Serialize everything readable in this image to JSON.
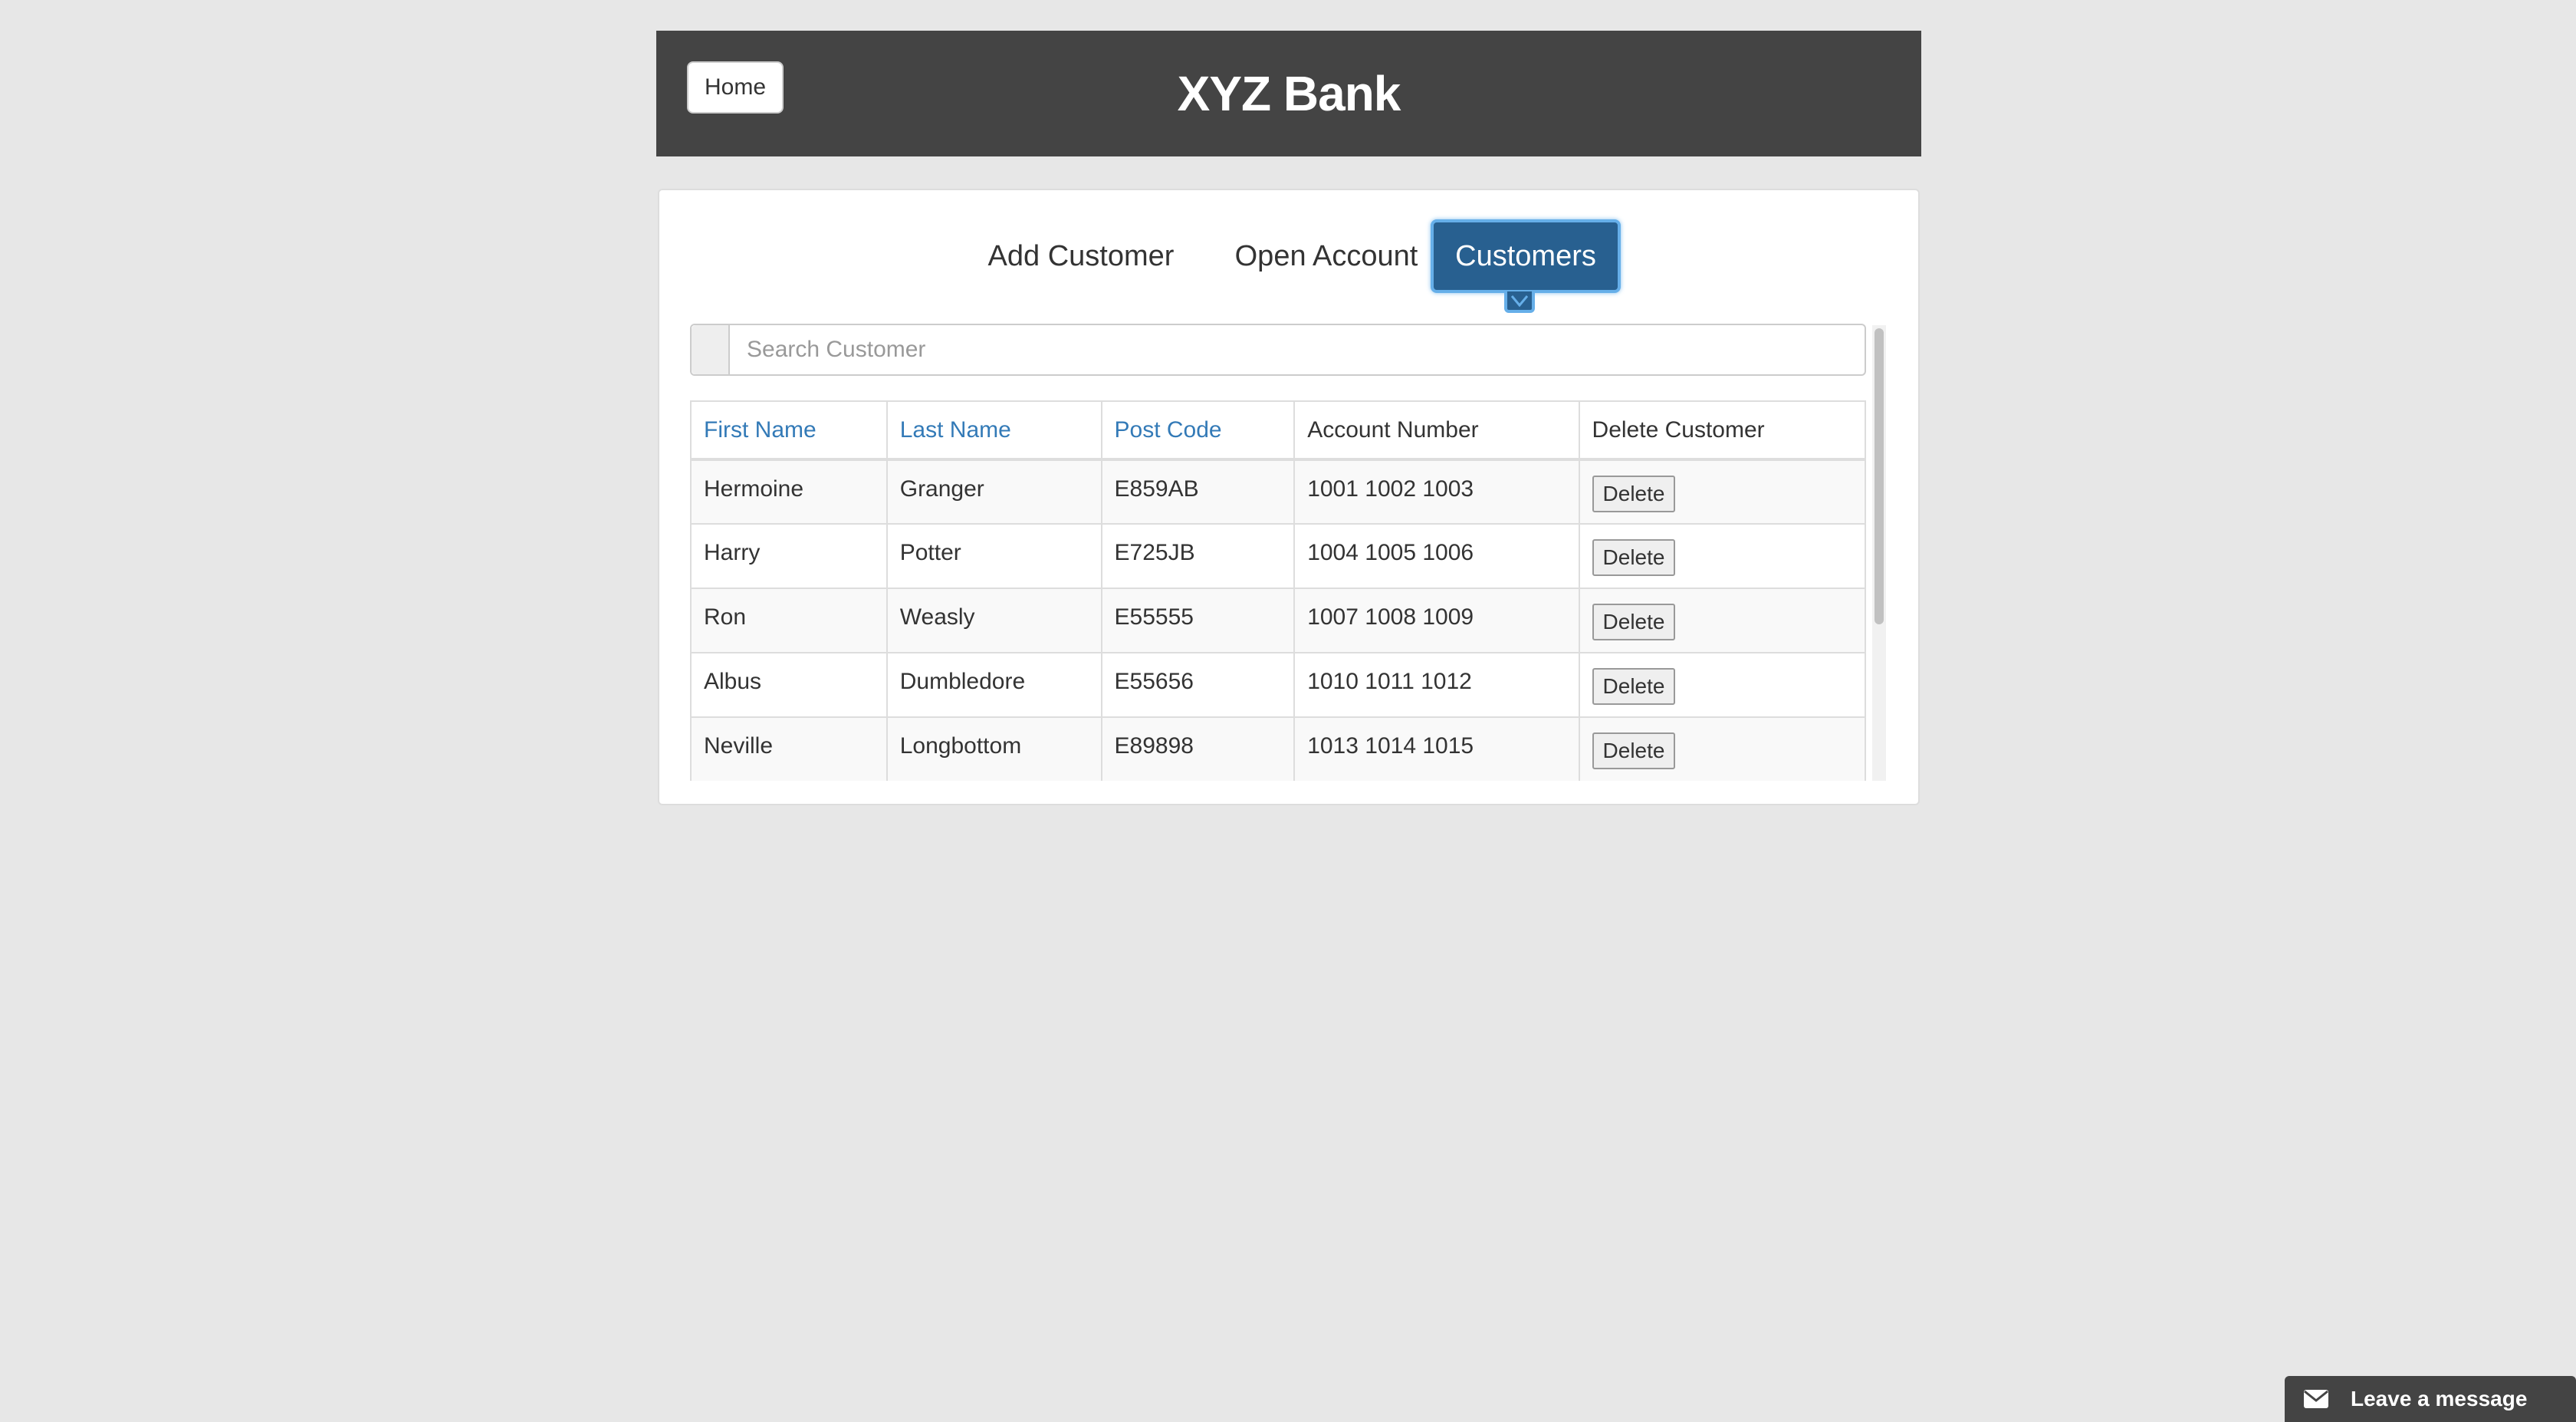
{
  "header": {
    "home_label": "Home",
    "title": "XYZ Bank"
  },
  "tabs": [
    {
      "label": "Add Customer",
      "active": false
    },
    {
      "label": "Open Account",
      "active": false
    },
    {
      "label": "Customers",
      "active": true
    }
  ],
  "search": {
    "placeholder": "Search Customer",
    "value": ""
  },
  "table": {
    "columns": [
      "First Name",
      "Last Name",
      "Post Code",
      "Account Number",
      "Delete Customer"
    ],
    "rows": [
      {
        "first_name": "Hermoine",
        "last_name": "Granger",
        "post_code": "E859AB",
        "account_number": "1001 1002 1003",
        "action": "Delete"
      },
      {
        "first_name": "Harry",
        "last_name": "Potter",
        "post_code": "E725JB",
        "account_number": "1004 1005 1006",
        "action": "Delete"
      },
      {
        "first_name": "Ron",
        "last_name": "Weasly",
        "post_code": "E55555",
        "account_number": "1007 1008 1009",
        "action": "Delete"
      },
      {
        "first_name": "Albus",
        "last_name": "Dumbledore",
        "post_code": "E55656",
        "account_number": "1010 1011 1012",
        "action": "Delete"
      },
      {
        "first_name": "Neville",
        "last_name": "Longbottom",
        "post_code": "E89898",
        "account_number": "1013 1014 1015",
        "action": "Delete"
      }
    ]
  },
  "chat": {
    "label": "Leave a message",
    "icon": "envelope-icon"
  },
  "colors": {
    "header_bg": "#444444",
    "page_bg": "#e7e7e7",
    "active_tab": "#286090",
    "link": "#337ab7"
  }
}
